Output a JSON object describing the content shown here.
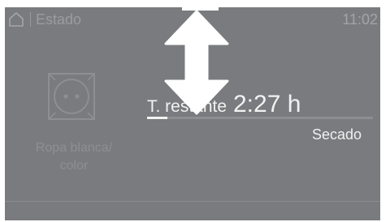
{
  "status_bar": {
    "title": "Estado",
    "time": "11:02",
    "home_icon": "home-icon"
  },
  "program": {
    "icon": "cotton-program-icon",
    "label_line1": "Ropa blanca/",
    "label_line2": "color"
  },
  "remaining": {
    "label": "T. restante",
    "value": "2:27 h"
  },
  "progress": {
    "fraction": 0.09
  },
  "phase": {
    "label": "Secado"
  },
  "overlay": {
    "icon": "vertical-drag-arrow-icon"
  },
  "colors": {
    "screen_background": "#7a7b7e",
    "highlight_text": "#f2f2f2",
    "dim_text": "#9b9c9f"
  }
}
